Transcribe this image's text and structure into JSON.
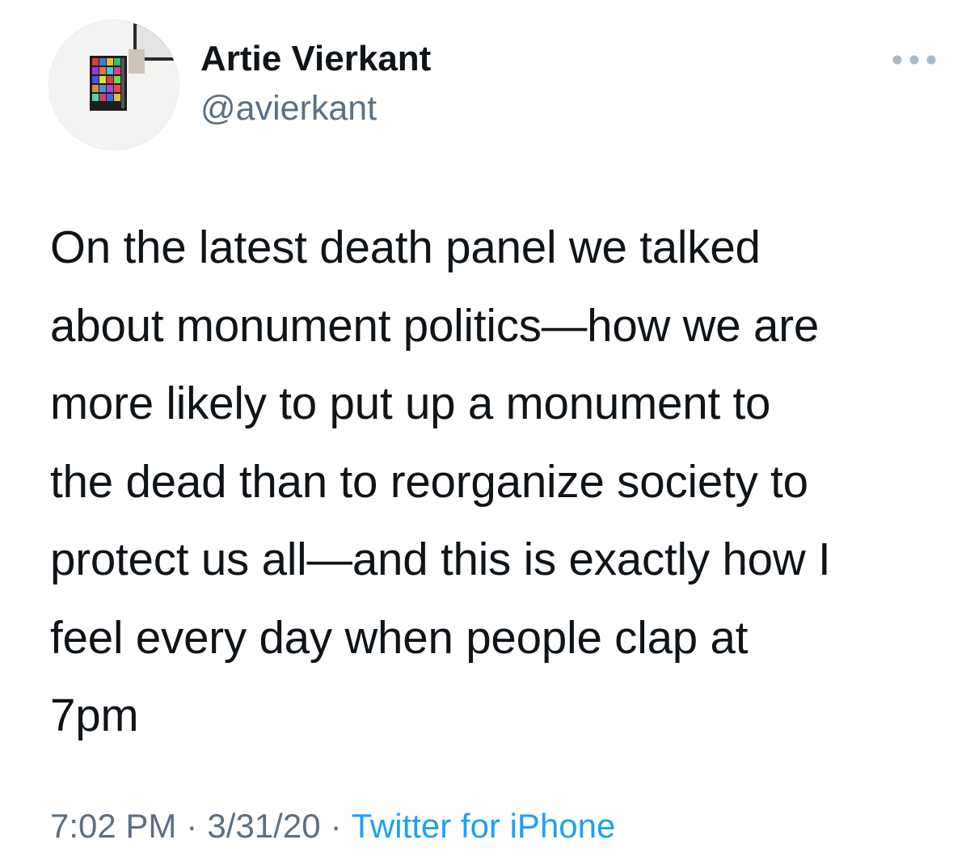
{
  "tweet": {
    "author_name": "Artie Vierkant",
    "author_handle": "@avierkant",
    "text": "On the latest death panel we talked\nabout monument politics—how we are\nmore likely to put up a monument to\nthe dead than to reorganize society to\nprotect us all—and this is exactly how I\nfeel every day when people clap at\n7pm",
    "time": "7:02 PM",
    "separator": "·",
    "date": "3/31/20",
    "source": "Twitter for iPhone"
  },
  "icons": {
    "more": "more-horizontal-icon"
  },
  "colors": {
    "text": "#0f1419",
    "secondary": "#5b7083",
    "link": "#1da1f2",
    "background": "#ffffff"
  }
}
